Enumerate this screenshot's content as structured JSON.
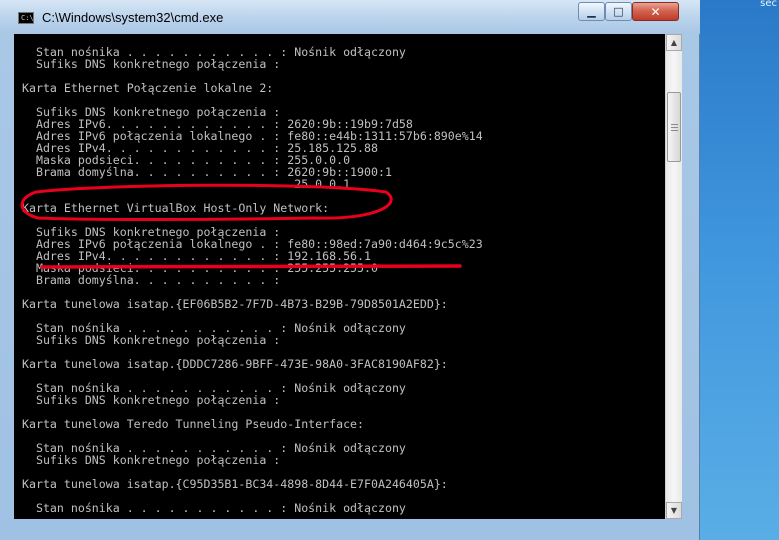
{
  "window": {
    "title": "C:\\Windows\\system32\\cmd.exe",
    "icon_text": "C:\\",
    "controls": {
      "minimize": "▁",
      "maximize": "□",
      "close": "✕"
    }
  },
  "desktop": {
    "corner_text": "sec"
  },
  "console": {
    "lines": [
      "  Stan nośnika . . . . . . . . . . . : Nośnik odłączony",
      "  Sufiks DNS konkretnego połączenia :",
      "",
      "Karta Ethernet Połączenie lokalne 2:",
      "",
      "  Sufiks DNS konkretnego połączenia :",
      "  Adres IPv6. . . . . . . . . . . . : 2620:9b::19b9:7d58",
      "  Adres IPv6 połączenia lokalnego . : fe80::e44b:1311:57b6:890e%14",
      "  Adres IPv4. . . . . . . . . . . . : 25.185.125.88",
      "  Maska podsieci. . . . . . . . . . : 255.0.0.0",
      "  Brama domyślna. . . . . . . . . . : 2620:9b::1900:1",
      "                                       25.0.0.1",
      "",
      "Karta Ethernet VirtualBox Host-Only Network:",
      "",
      "  Sufiks DNS konkretnego połączenia :",
      "  Adres IPv6 połączenia lokalnego . : fe80::98ed:7a90:d464:9c5c%23",
      "  Adres IPv4. . . . . . . . . . . . : 192.168.56.1",
      "  Maska podsieci. . . . . . . . . . : 255.255.255.0",
      "  Brama domyślna. . . . . . . . . . :",
      "",
      "Karta tunelowa isatap.{EF06B5B2-7F7D-4B73-B29B-79D8501A2EDD}:",
      "",
      "  Stan nośnika . . . . . . . . . . . : Nośnik odłączony",
      "  Sufiks DNS konkretnego połączenia :",
      "",
      "Karta tunelowa isatap.{DDDC7286-9BFF-473E-98A0-3FAC8190AF82}:",
      "",
      "  Stan nośnika . . . . . . . . . . . : Nośnik odłączony",
      "  Sufiks DNS konkretnego połączenia :",
      "",
      "Karta tunelowa Teredo Tunneling Pseudo-Interface:",
      "",
      "  Stan nośnika . . . . . . . . . . . : Nośnik odłączony",
      "  Sufiks DNS konkretnego połączenia :",
      "",
      "Karta tunelowa isatap.{C95D35B1-BC34-4898-8D44-E7F0A246405A}:",
      "",
      "  Stan nośnika . . . . . . . . . . . : Nośnik odłączony"
    ]
  },
  "colors": {
    "console_bg": "#000000",
    "console_text": "#c0c0c0",
    "annotation": "#e8001c"
  }
}
